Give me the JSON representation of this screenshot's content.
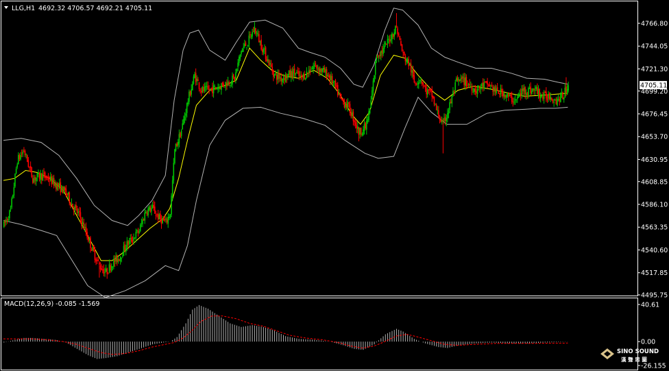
{
  "window": {
    "symbol": "LLG,H1",
    "ohlc": "4692.32 4706.57 4692.21 4705.11",
    "current_price_label": "4705.11",
    "colors": {
      "background": "#000000",
      "bull": "#00c800",
      "bear": "#ff0000",
      "bands": "#b4b4b4",
      "middle": "#ffff00",
      "macd_hist": "#c0c0c0",
      "signal": "#ff0000",
      "frame": "#ffffff"
    }
  },
  "price_axis_labels": [
    "4766.80",
    "4744.05",
    "4721.30",
    "4699.20",
    "4676.45",
    "4653.70",
    "4630.95",
    "4608.85",
    "4586.10",
    "4563.35",
    "4540.60",
    "4517.85",
    "4495.75"
  ],
  "macd": {
    "label": "MACD(12,26,9) -0.085 -1.569",
    "axis_labels": [
      "40.61",
      "0.00",
      "-26.155"
    ]
  },
  "logo": {
    "name": "SINO SOUND",
    "sub": "漢 聲 思 圖"
  },
  "chart_data": [
    {
      "type": "candlestick",
      "title": "LLG,H1",
      "ylim": [
        4495.75,
        4780
      ],
      "close_path": [
        [
          0,
          4565
        ],
        [
          6,
          4580
        ],
        [
          12,
          4630
        ],
        [
          18,
          4640
        ],
        [
          26,
          4612
        ],
        [
          34,
          4615
        ],
        [
          40,
          4612
        ],
        [
          48,
          4605
        ],
        [
          56,
          4598
        ],
        [
          62,
          4585
        ],
        [
          68,
          4575
        ],
        [
          74,
          4558
        ],
        [
          80,
          4540
        ],
        [
          86,
          4525
        ],
        [
          92,
          4518
        ],
        [
          98,
          4528
        ],
        [
          104,
          4533
        ],
        [
          110,
          4545
        ],
        [
          116,
          4552
        ],
        [
          122,
          4560
        ],
        [
          128,
          4580
        ],
        [
          134,
          4582
        ],
        [
          140,
          4572
        ],
        [
          146,
          4568
        ],
        [
          150,
          4578
        ],
        [
          154,
          4640
        ],
        [
          160,
          4660
        ],
        [
          166,
          4690
        ],
        [
          172,
          4715
        ],
        [
          178,
          4700
        ],
        [
          184,
          4700
        ],
        [
          190,
          4702
        ],
        [
          196,
          4705
        ],
        [
          202,
          4708
        ],
        [
          208,
          4712
        ],
        [
          214,
          4740
        ],
        [
          220,
          4748
        ],
        [
          226,
          4762
        ],
        [
          232,
          4745
        ],
        [
          238,
          4730
        ],
        [
          244,
          4715
        ],
        [
          250,
          4712
        ],
        [
          256,
          4715
        ],
        [
          262,
          4718
        ],
        [
          268,
          4712
        ],
        [
          274,
          4718
        ],
        [
          280,
          4725
        ],
        [
          286,
          4720
        ],
        [
          292,
          4716
        ],
        [
          298,
          4705
        ],
        [
          304,
          4690
        ],
        [
          310,
          4685
        ],
        [
          316,
          4670
        ],
        [
          320,
          4658
        ],
        [
          326,
          4663
        ],
        [
          330,
          4680
        ],
        [
          336,
          4735
        ],
        [
          342,
          4740
        ],
        [
          348,
          4752
        ],
        [
          354,
          4763
        ],
        [
          360,
          4735
        ],
        [
          366,
          4725
        ],
        [
          370,
          4708
        ],
        [
          376,
          4712
        ],
        [
          380,
          4700
        ],
        [
          386,
          4695
        ],
        [
          390,
          4680
        ],
        [
          396,
          4665
        ],
        [
          402,
          4685
        ],
        [
          408,
          4708
        ],
        [
          414,
          4710
        ],
        [
          420,
          4705
        ],
        [
          426,
          4700
        ],
        [
          432,
          4705
        ],
        [
          438,
          4705
        ],
        [
          444,
          4698
        ],
        [
          450,
          4698
        ],
        [
          456,
          4692
        ],
        [
          462,
          4690
        ],
        [
          468,
          4700
        ],
        [
          474,
          4700
        ],
        [
          480,
          4700
        ],
        [
          486,
          4693
        ],
        [
          492,
          4695
        ],
        [
          498,
          4690
        ],
        [
          504,
          4694
        ],
        [
          509,
          4705
        ]
      ],
      "bollinger": {
        "upper": [
          [
            0,
            4650
          ],
          [
            16,
            4652
          ],
          [
            34,
            4648
          ],
          [
            50,
            4635
          ],
          [
            66,
            4612
          ],
          [
            82,
            4585
          ],
          [
            98,
            4570
          ],
          [
            112,
            4565
          ],
          [
            122,
            4575
          ],
          [
            134,
            4590
          ],
          [
            146,
            4615
          ],
          [
            154,
            4690
          ],
          [
            162,
            4740
          ],
          [
            168,
            4757
          ],
          [
            176,
            4760
          ],
          [
            186,
            4740
          ],
          [
            200,
            4730
          ],
          [
            210,
            4748
          ],
          [
            222,
            4768
          ],
          [
            236,
            4770
          ],
          [
            252,
            4762
          ],
          [
            266,
            4742
          ],
          [
            276,
            4738
          ],
          [
            290,
            4733
          ],
          [
            304,
            4722
          ],
          [
            316,
            4706
          ],
          [
            324,
            4703
          ],
          [
            334,
            4725
          ],
          [
            344,
            4760
          ],
          [
            352,
            4782
          ],
          [
            360,
            4780
          ],
          [
            374,
            4765
          ],
          [
            386,
            4742
          ],
          [
            398,
            4733
          ],
          [
            410,
            4728
          ],
          [
            426,
            4722
          ],
          [
            440,
            4722
          ],
          [
            458,
            4717
          ],
          [
            472,
            4712
          ],
          [
            488,
            4711
          ],
          [
            500,
            4708
          ],
          [
            509,
            4706
          ]
        ],
        "lower": [
          [
            0,
            4570
          ],
          [
            16,
            4566
          ],
          [
            34,
            4560
          ],
          [
            48,
            4555
          ],
          [
            62,
            4530
          ],
          [
            76,
            4505
          ],
          [
            92,
            4493
          ],
          [
            110,
            4500
          ],
          [
            128,
            4510
          ],
          [
            146,
            4525
          ],
          [
            158,
            4520
          ],
          [
            166,
            4545
          ],
          [
            174,
            4590
          ],
          [
            186,
            4645
          ],
          [
            200,
            4670
          ],
          [
            216,
            4682
          ],
          [
            232,
            4683
          ],
          [
            250,
            4677
          ],
          [
            270,
            4672
          ],
          [
            290,
            4665
          ],
          [
            308,
            4650
          ],
          [
            326,
            4637
          ],
          [
            338,
            4632
          ],
          [
            352,
            4634
          ],
          [
            362,
            4662
          ],
          [
            374,
            4693
          ],
          [
            386,
            4678
          ],
          [
            400,
            4666
          ],
          [
            418,
            4666
          ],
          [
            436,
            4677
          ],
          [
            452,
            4680
          ],
          [
            470,
            4681
          ],
          [
            484,
            4682
          ],
          [
            498,
            4682
          ],
          [
            509,
            4683
          ]
        ],
        "middle": [
          [
            0,
            4610
          ],
          [
            10,
            4612
          ],
          [
            20,
            4620
          ],
          [
            30,
            4618
          ],
          [
            42,
            4612
          ],
          [
            54,
            4600
          ],
          [
            66,
            4575
          ],
          [
            76,
            4555
          ],
          [
            88,
            4530
          ],
          [
            98,
            4530
          ],
          [
            108,
            4538
          ],
          [
            120,
            4550
          ],
          [
            132,
            4562
          ],
          [
            144,
            4572
          ],
          [
            150,
            4582
          ],
          [
            158,
            4612
          ],
          [
            166,
            4650
          ],
          [
            174,
            4685
          ],
          [
            186,
            4700
          ],
          [
            198,
            4704
          ],
          [
            210,
            4710
          ],
          [
            222,
            4742
          ],
          [
            232,
            4730
          ],
          [
            242,
            4720
          ],
          [
            254,
            4714
          ],
          [
            266,
            4712
          ],
          [
            280,
            4720
          ],
          [
            292,
            4712
          ],
          [
            304,
            4695
          ],
          [
            314,
            4676
          ],
          [
            322,
            4666
          ],
          [
            330,
            4678
          ],
          [
            340,
            4715
          ],
          [
            352,
            4735
          ],
          [
            362,
            4732
          ],
          [
            374,
            4715
          ],
          [
            388,
            4698
          ],
          [
            398,
            4690
          ],
          [
            410,
            4700
          ],
          [
            424,
            4704
          ],
          [
            440,
            4701
          ],
          [
            456,
            4697
          ],
          [
            470,
            4694
          ],
          [
            486,
            4695
          ],
          [
            498,
            4696
          ],
          [
            509,
            4697
          ]
        ]
      },
      "candles": {
        "count": 510,
        "xlim": [
          0,
          509
        ],
        "x_note": "bar index",
        "extreme_highs": [
          [
            226,
            4767
          ],
          [
            354,
            4777
          ],
          [
            507,
            4713
          ]
        ],
        "extreme_lows": [
          [
            86,
            4513
          ],
          [
            320,
            4649
          ],
          [
            396,
            4637
          ]
        ]
      }
    },
    {
      "type": "bar",
      "title": "MACD(12,26,9) -0.085 -1.569",
      "ylim": [
        -26.155,
        40.61
      ],
      "x_note": "bar index",
      "histogram_path": [
        [
          0,
          -1
        ],
        [
          10,
          2
        ],
        [
          18,
          4
        ],
        [
          26,
          4
        ],
        [
          36,
          3
        ],
        [
          46,
          2
        ],
        [
          56,
          -1
        ],
        [
          66,
          -8
        ],
        [
          76,
          -15
        ],
        [
          84,
          -19
        ],
        [
          92,
          -18
        ],
        [
          102,
          -16
        ],
        [
          112,
          -12
        ],
        [
          122,
          -8
        ],
        [
          134,
          -3
        ],
        [
          144,
          -1
        ],
        [
          150,
          0
        ],
        [
          156,
          5
        ],
        [
          164,
          20
        ],
        [
          170,
          35
        ],
        [
          176,
          40
        ],
        [
          184,
          36
        ],
        [
          194,
          28
        ],
        [
          204,
          20
        ],
        [
          214,
          16
        ],
        [
          224,
          18
        ],
        [
          234,
          16
        ],
        [
          244,
          12
        ],
        [
          254,
          6
        ],
        [
          266,
          3
        ],
        [
          280,
          2
        ],
        [
          294,
          0
        ],
        [
          306,
          -4
        ],
        [
          316,
          -8
        ],
        [
          324,
          -9
        ],
        [
          334,
          -3
        ],
        [
          344,
          8
        ],
        [
          354,
          14
        ],
        [
          360,
          11
        ],
        [
          370,
          3
        ],
        [
          380,
          -2
        ],
        [
          392,
          -6
        ],
        [
          400,
          -7
        ],
        [
          410,
          -4
        ],
        [
          424,
          -2
        ],
        [
          440,
          -1
        ],
        [
          456,
          -2
        ],
        [
          472,
          -2
        ],
        [
          488,
          -1
        ],
        [
          509,
          -0.1
        ]
      ],
      "signal_path": [
        [
          0,
          3
        ],
        [
          14,
          3
        ],
        [
          26,
          3
        ],
        [
          40,
          2
        ],
        [
          54,
          0
        ],
        [
          66,
          -3
        ],
        [
          78,
          -8
        ],
        [
          88,
          -12
        ],
        [
          98,
          -14
        ],
        [
          110,
          -13
        ],
        [
          122,
          -10
        ],
        [
          134,
          -6
        ],
        [
          146,
          -3
        ],
        [
          154,
          -1
        ],
        [
          162,
          4
        ],
        [
          170,
          12
        ],
        [
          178,
          22
        ],
        [
          188,
          28
        ],
        [
          198,
          28
        ],
        [
          210,
          25
        ],
        [
          222,
          20
        ],
        [
          234,
          17
        ],
        [
          246,
          12
        ],
        [
          258,
          7
        ],
        [
          272,
          4
        ],
        [
          288,
          2
        ],
        [
          302,
          -1
        ],
        [
          314,
          -5
        ],
        [
          324,
          -7
        ],
        [
          334,
          -5
        ],
        [
          344,
          0
        ],
        [
          354,
          6
        ],
        [
          364,
          8
        ],
        [
          374,
          5
        ],
        [
          386,
          1
        ],
        [
          398,
          -3
        ],
        [
          410,
          -4
        ],
        [
          426,
          -3
        ],
        [
          444,
          -2
        ],
        [
          462,
          -2
        ],
        [
          478,
          -2
        ],
        [
          494,
          -1.7
        ],
        [
          509,
          -1.6
        ]
      ]
    }
  ]
}
